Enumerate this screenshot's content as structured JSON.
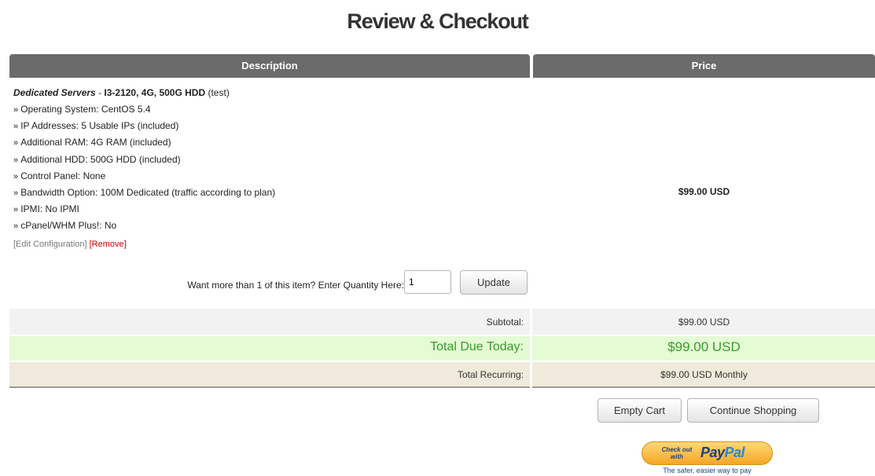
{
  "page": {
    "title": "Review & Checkout"
  },
  "table": {
    "col_description": "Description",
    "col_price": "Price"
  },
  "item": {
    "name": "Dedicated Servers",
    "separator": " - ",
    "model": "I3-2120, 4G, 500G HDD",
    "group": " (test)",
    "options": [
      "Operating System: CentOS 5.4",
      "IP Addresses: 5 Usable IPs (included)",
      "Additional RAM: 4G RAM (included)",
      "Additional HDD: 500G HDD (included)",
      "Control Panel: None",
      "Bandwidth Option: 100M Dedicated (traffic according to plan)",
      "IPMI: No IPMI",
      "cPanel/WHM Plus!: No"
    ],
    "edit_label": "[Edit Configuration]",
    "remove_label": "[Remove]",
    "price": "$99.00 USD"
  },
  "quantity": {
    "label": "Want more than 1 of this item? Enter Quantity Here:",
    "value": "1",
    "update_label": "Update"
  },
  "totals": {
    "subtotal_label": "Subtotal:",
    "subtotal_value": "$99.00 USD",
    "due_label": "Total Due Today:",
    "due_value": "$99.00 USD",
    "recurring_label": "Total Recurring:",
    "recurring_value": "$99.00 USD Monthly"
  },
  "actions": {
    "empty_cart": "Empty Cart",
    "continue_shopping": "Continue Shopping"
  },
  "paypal": {
    "small_text": "Check out with",
    "brand_pay": "Pay",
    "brand_pal": "Pal",
    "tagline": "The safer, easier way to pay"
  },
  "colors": {
    "header_bg": "#6b6b6b",
    "total_bg": "#e4fbd4",
    "total_text": "#3a9a2a",
    "remove_link": "#cc0000",
    "recurring_bg": "#efeadb"
  }
}
